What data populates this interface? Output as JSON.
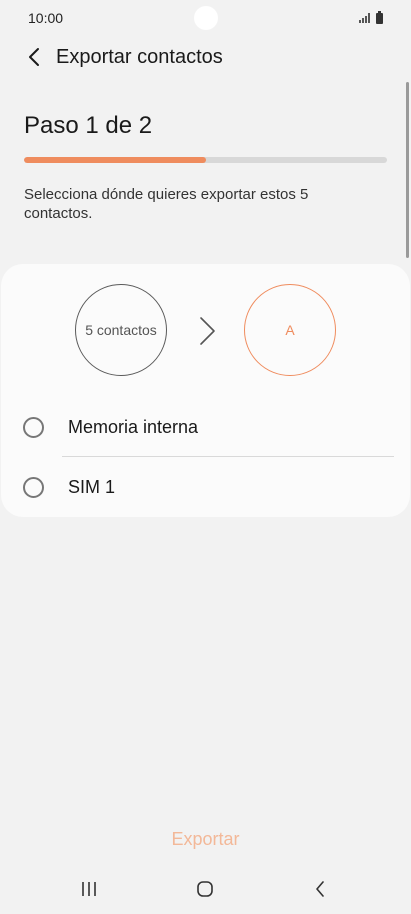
{
  "status_bar": {
    "time": "10:00",
    "signal_icon": "signal-icon",
    "battery_icon": "battery-icon"
  },
  "header": {
    "back_icon": "chevron-left-icon",
    "title": "Exportar contactos"
  },
  "step": {
    "title": "Paso 1 de 2",
    "progress_fraction": 0.5
  },
  "description": "Selecciona dónde quieres exportar estos 5 contactos.",
  "card": {
    "source_label": "5 contactos",
    "arrow_icon": "chevron-right-icon",
    "target_label": "A",
    "options": [
      {
        "label": "Memoria interna",
        "selected": false
      },
      {
        "label": "SIM 1",
        "selected": false
      }
    ]
  },
  "footer": {
    "export_label": "Exportar"
  },
  "nav_bar": {
    "recent_icon": "recent-apps-icon",
    "home_icon": "home-icon",
    "back_icon": "back-icon"
  },
  "colors": {
    "accent": "#ef8c5e",
    "export_disabled": "#f3b898",
    "background": "#f2f2f2"
  }
}
